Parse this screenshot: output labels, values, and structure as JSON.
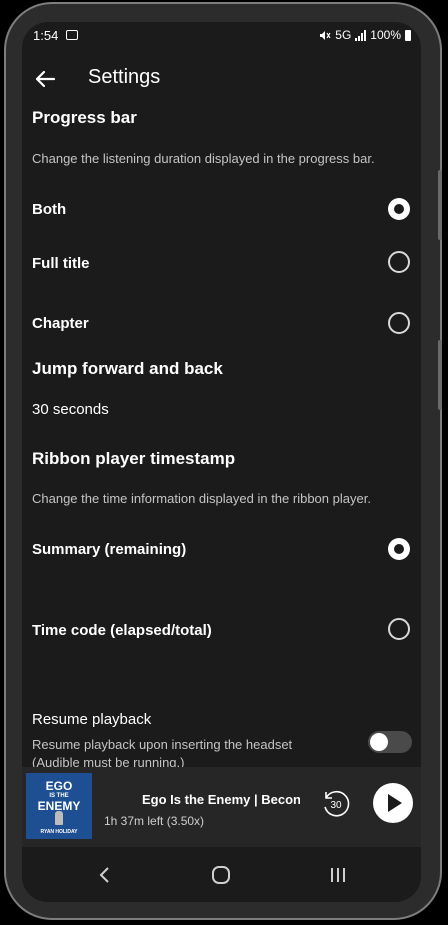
{
  "status": {
    "time": "1:54",
    "network": "5G",
    "battery": "100%"
  },
  "appbar": {
    "title": "Settings"
  },
  "progress_bar": {
    "title": "Progress bar",
    "description": "Change the listening duration displayed in the progress bar.",
    "options": [
      {
        "label": "Both",
        "selected": true
      },
      {
        "label": "Full title",
        "selected": false
      },
      {
        "label": "Chapter",
        "selected": false
      }
    ]
  },
  "jump": {
    "title": "Jump forward and back",
    "value": "30 seconds"
  },
  "ribbon": {
    "title": "Ribbon player timestamp",
    "description": "Change the time information displayed in the ribbon player.",
    "options": [
      {
        "label": "Summary (remaining)",
        "selected": true
      },
      {
        "label": "Time code (elapsed/total)",
        "selected": false
      }
    ]
  },
  "resume": {
    "title": "Resume playback",
    "description_line1": "Resume playback upon inserting the headset",
    "description_line2": "(Audible must be running.)",
    "enabled": false
  },
  "player": {
    "cover": {
      "line1": "EGO",
      "line2": "IS THE",
      "line3": "ENEMY",
      "author": "RYAN HOLIDAY"
    },
    "title": "Ego Is the Enemy | Becon",
    "subtitle": "1h 37m left (3.50x)",
    "skip_label": "30"
  },
  "icons": {
    "back": "arrow-left-icon",
    "play": "play-icon",
    "skip": "replay-30-icon",
    "nav_back": "chevron-left-icon",
    "nav_home": "home-icon",
    "nav_recents": "recents-icon"
  }
}
